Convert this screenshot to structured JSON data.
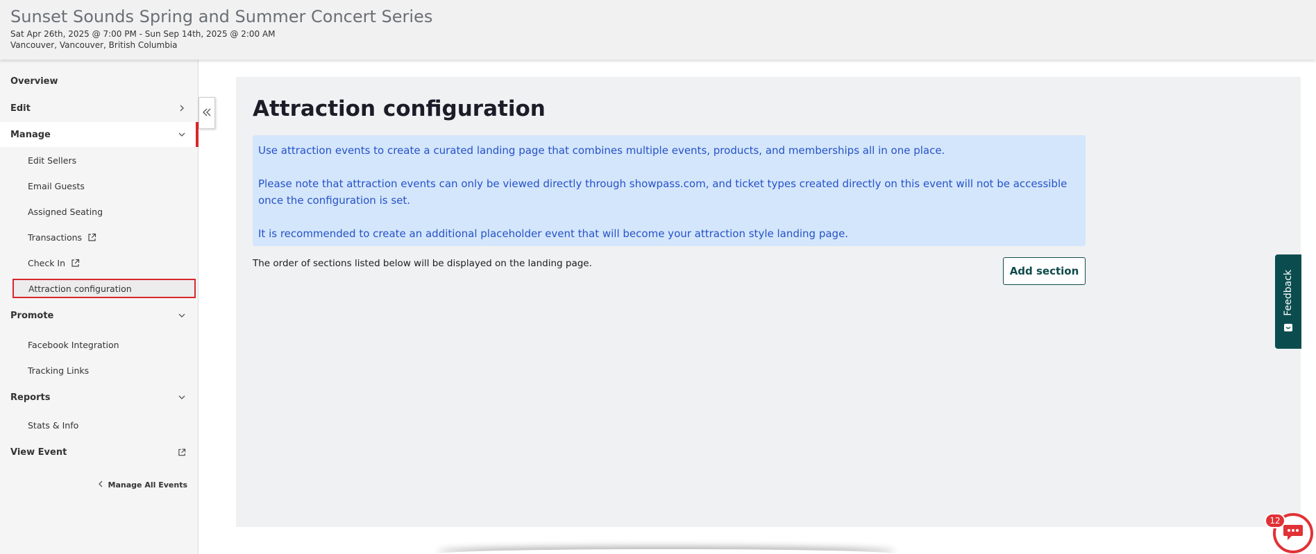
{
  "header": {
    "title": "Sunset Sounds Spring and Summer Concert Series",
    "date_range": "Sat Apr 26th, 2025 @ 7:00 PM - Sun Sep 14th, 2025 @ 2:00 AM",
    "location": "Vancouver, Vancouver, British Columbia"
  },
  "sidebar": {
    "overview": "Overview",
    "edit": "Edit",
    "manage": "Manage",
    "manage_items": {
      "edit_sellers": "Edit Sellers",
      "email_guests": "Email Guests",
      "assigned_seating": "Assigned Seating",
      "transactions": "Transactions",
      "check_in": "Check In",
      "attraction_configuration": "Attraction configuration"
    },
    "promote": "Promote",
    "promote_items": {
      "facebook_integration": "Facebook Integration",
      "tracking_links": "Tracking Links"
    },
    "reports": "Reports",
    "reports_items": {
      "stats_info": "Stats & Info"
    },
    "view_event": "View Event",
    "manage_all_events": "Manage All Events",
    "active_color": "#d9262c"
  },
  "main": {
    "title": "Attraction configuration",
    "info_lines": [
      "Use attraction events to create a curated landing page that combines multiple events, products, and memberships all in one place.",
      "Please note that attraction events can only be viewed directly through showpass.com, and ticket types created directly on this event will not be accessible once the configuration is set.",
      "It is recommended to create an additional placeholder event that will become your attraction style landing page."
    ],
    "order_text": "The order of sections listed below will be displayed on the landing page.",
    "add_section_label": "Add section"
  },
  "feedback": {
    "label": "Feedback"
  },
  "chat": {
    "badge_count": "12"
  },
  "icons": {
    "collapse": "double-chevron-left-icon",
    "external": "external-link-icon",
    "chat": "chat-bubble-icon"
  }
}
